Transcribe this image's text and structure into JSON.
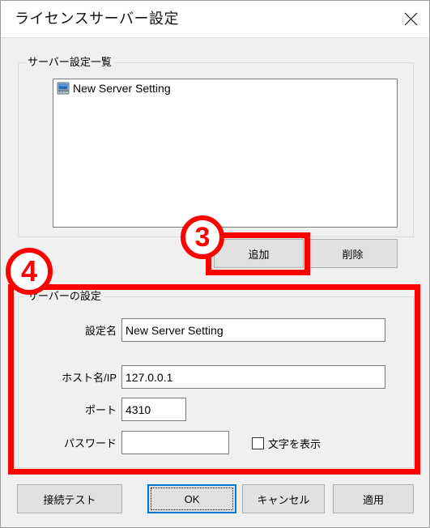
{
  "window": {
    "title": "ライセンスサーバー設定",
    "close_icon": "close-icon"
  },
  "server_list_group": {
    "label": "サーバー設定一覧",
    "items": [
      {
        "icon": "computer-icon",
        "label": "New Server Setting"
      }
    ],
    "buttons": {
      "add": "追加",
      "delete": "削除"
    }
  },
  "server_settings_group": {
    "label": "サーバーの設定",
    "fields": [
      {
        "label": "設定名",
        "value": "New Server Setting",
        "placeholder": ""
      },
      {
        "label": "ホスト名/IP",
        "value": "127.0.0.1",
        "placeholder": ""
      },
      {
        "label": "ポート",
        "value": "4310",
        "placeholder": ""
      },
      {
        "label": "パスワード",
        "value": "",
        "placeholder": ""
      }
    ],
    "show_characters_checkbox": {
      "label": "文字を表示",
      "checked": false
    }
  },
  "footer": {
    "connection_test": "接続テスト",
    "ok": "OK",
    "cancel": "キャンセル",
    "apply": "適用"
  },
  "annotations": [
    {
      "marker": "3",
      "target": "追加"
    },
    {
      "marker": "4",
      "target": "サーバーの設定"
    }
  ],
  "colors": {
    "annotation_red": "#ff0000",
    "focus_blue": "#0078d7",
    "dialog_background": "#f0f0f0",
    "field_background": "#ffffff"
  }
}
